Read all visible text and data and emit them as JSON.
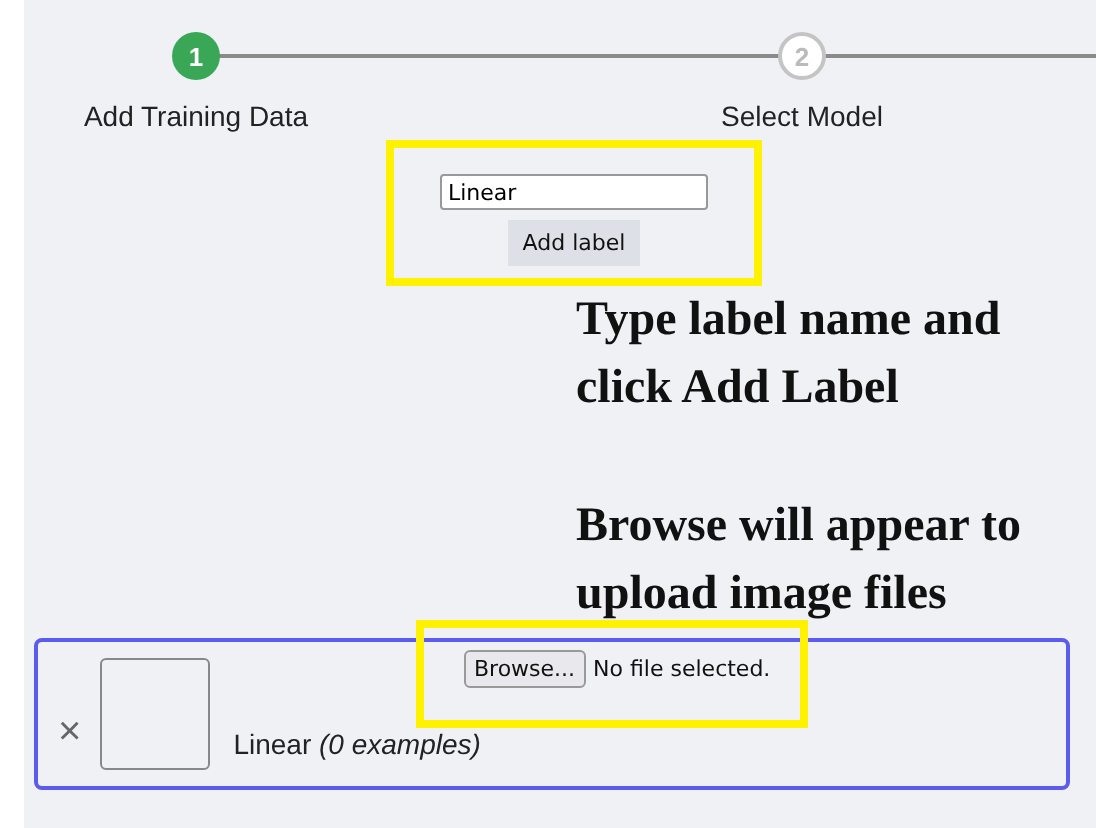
{
  "stepper": {
    "steps": [
      {
        "number": "1",
        "label": "Add Training Data",
        "selected": true
      },
      {
        "number": "2",
        "label": "Select Model",
        "selected": false
      }
    ]
  },
  "label_form": {
    "input_value": "Linear",
    "button": "Add label"
  },
  "annotations": [
    "Type label name and click Add Label",
    "Browse will appear to upload image files"
  ],
  "label_cards": [
    {
      "close": "×",
      "label": "Linear *(0 examples)*",
      "file_button": "Browse...",
      "file_status": "No file selected."
    }
  ]
}
